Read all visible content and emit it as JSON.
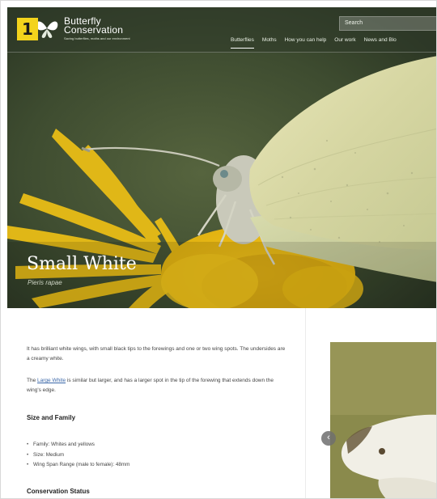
{
  "badge": {
    "number": "1"
  },
  "header": {
    "logo": {
      "line1": "Butterfly",
      "line2": "Conservation",
      "tagline": "Saving butterflies, moths and our environment"
    },
    "search": {
      "placeholder": "Search"
    },
    "nav": [
      {
        "label": "Butterflies",
        "active": true
      },
      {
        "label": "Moths"
      },
      {
        "label": "How you can help"
      },
      {
        "label": "Our work"
      },
      {
        "label": "News and Blo"
      }
    ]
  },
  "hero": {
    "title": "Small White",
    "latin": "Pieris rapae"
  },
  "content": {
    "intro": "It has brilliant white wings, with small black tips to the forewings and one or two wing spots. The undersides are a creamy white.",
    "compare": {
      "prefix": "The ",
      "link": "Large White",
      "suffix": " is similar but larger, and has a larger spot in the tip of the forewing that extends down the wing's edge."
    },
    "size_heading": "Size and Family",
    "facts": [
      "Family: Whites and yellows",
      "Size: Medium",
      "Wing Span Range (male to female): 48mm"
    ],
    "conservation_heading": "Conservation Status"
  },
  "colors": {
    "badge": "#f3d31c",
    "link": "#3b67a8",
    "hero_bg": "#3c4a2f"
  },
  "icons": {
    "carousel_prev": "chevron-left-icon",
    "logo": "butterfly-icon"
  }
}
